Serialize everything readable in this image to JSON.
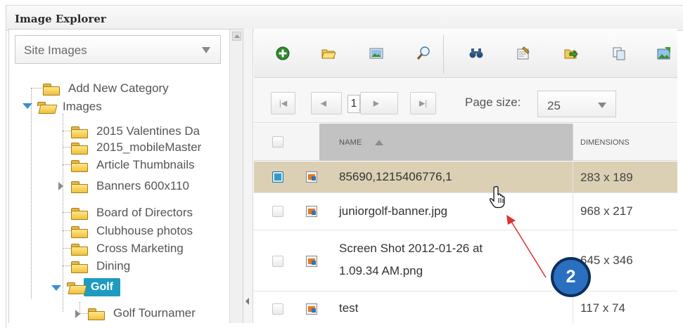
{
  "window": {
    "title": "Image Explorer"
  },
  "sidebar": {
    "dropdown_value": "Site Images",
    "tree": {
      "add_new": "Add New Category",
      "images": "Images",
      "children": [
        "2015 Valentines Da",
        "2015_mobileMaster",
        "Article Thumbnails",
        "Banners 600x110",
        "Board of Directors",
        "Clubhouse photos",
        "Cross Marketing",
        "Dining",
        "Golf",
        "Golf Tournamer"
      ]
    }
  },
  "toolbar": {
    "buttons": [
      "add-icon",
      "open-folder-icon",
      "image-icon",
      "search-icon",
      "find-icon",
      "edit-icon",
      "move-icon",
      "copy-icon",
      "replace-image-icon"
    ]
  },
  "pager": {
    "current_page": "1",
    "page_size_label": "Page size:",
    "page_size_value": "25"
  },
  "grid": {
    "columns": {
      "name": "NAME",
      "dimensions": "DIMENSIONS"
    },
    "rows": [
      {
        "name": "85690,1215406776,1",
        "dimensions": "283 x 189",
        "selected": true
      },
      {
        "name": "juniorgolf-banner.jpg",
        "dimensions": "968 x 217",
        "selected": false
      },
      {
        "name_line1": "Screen Shot 2012-01-26 at",
        "name_line2": "1.09.34 AM.png",
        "dimensions": "645 x 346",
        "selected": false
      },
      {
        "name": "test",
        "dimensions": "117 x 74",
        "selected": false
      }
    ]
  },
  "annotation": {
    "step": "2",
    "color": "#2a6fc0"
  }
}
